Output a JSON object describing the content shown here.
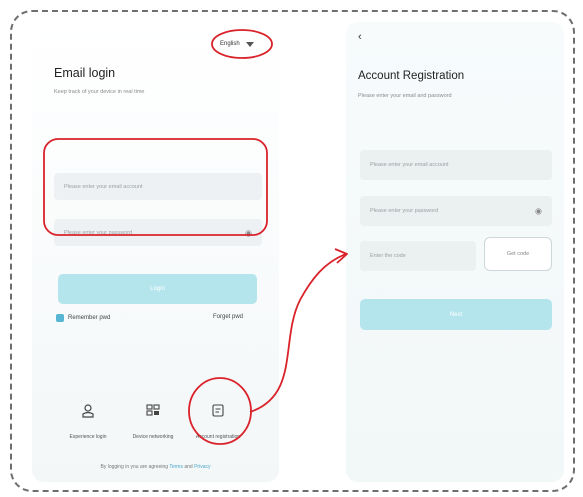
{
  "login": {
    "language": "English",
    "title": "Email login",
    "subtitle": "Keep track of your device in real time",
    "email_placeholder": "Please enter your email account",
    "password_placeholder": "Please enter your password",
    "login_label": "Login",
    "remember_label": "Remember pwd",
    "forgot_label": "Forget pwd",
    "options": [
      {
        "label": "Experience login",
        "icon": "person-icon"
      },
      {
        "label": "Device networking",
        "icon": "network-icon"
      },
      {
        "label": "Account registration",
        "icon": "register-icon"
      }
    ],
    "agreement": {
      "prefix": "By logging in you are agreeing",
      "terms": "Terms",
      "and": "and",
      "privacy": "Privacy"
    }
  },
  "register": {
    "title": "Account Registration",
    "subtitle": "Please enter your email and password",
    "email_placeholder": "Please enter your email account",
    "password_placeholder": "Please enter your password",
    "code_placeholder": "Enter the code",
    "get_code_label": "Get code",
    "next_label": "Next"
  },
  "colors": {
    "accent": "#b4e5ec",
    "annotation": "#d9222a",
    "checkbox": "#57b6d3"
  }
}
